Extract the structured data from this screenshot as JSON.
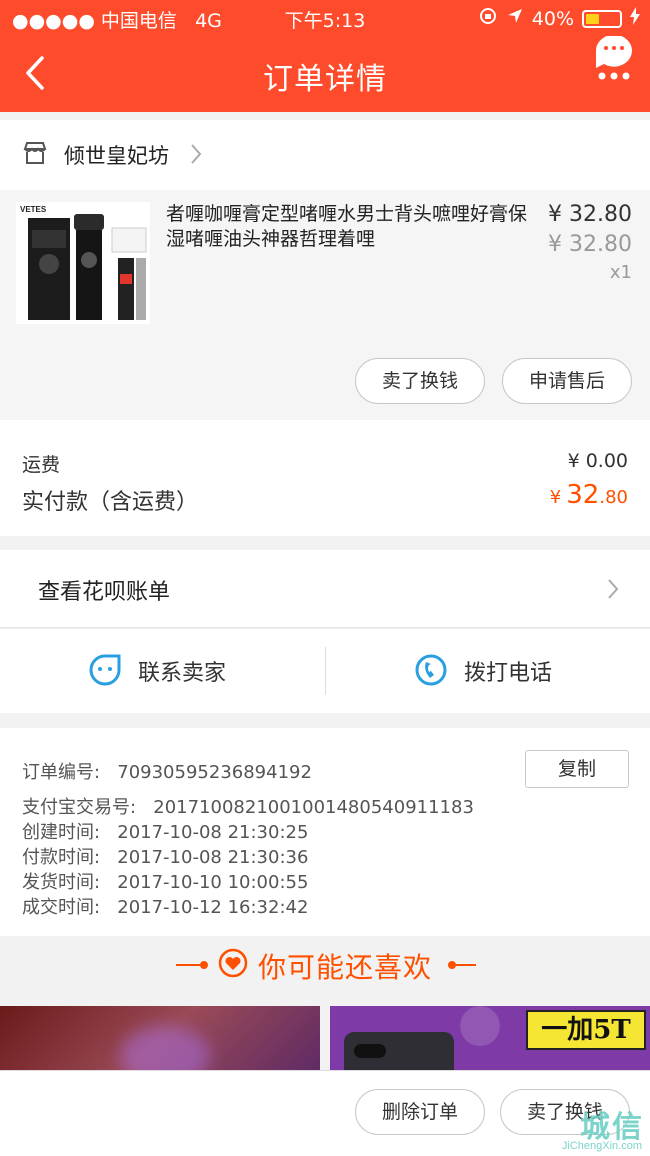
{
  "status_bar": {
    "carrier": "●●●●● 中国电信",
    "network": "4G",
    "time": "下午5:13",
    "battery_percent": "40%",
    "battery_level": 0.4
  },
  "nav": {
    "title": "订单详情"
  },
  "shop": {
    "name": "倾世皇妃坊"
  },
  "item": {
    "image_label": "VETES",
    "title": "者喱咖喱膏定型啫喱水男士背头嗻哩好膏保湿啫喱油头神器哲理着哩",
    "price": "¥ 32.80",
    "original_price": "¥ 32.80",
    "quantity": "x1",
    "button_sell": "卖了换钱",
    "button_after_sale": "申请售后"
  },
  "fees": {
    "shipping_label": "运费",
    "shipping_value": "¥ 0.00",
    "paid_label": "实付款（含运费）",
    "paid_currency": "¥",
    "paid_integer": "32",
    "paid_decimal": ".80"
  },
  "huabei": {
    "label": "查看花呗账单"
  },
  "contact": {
    "seller_label": "联系卖家",
    "phone_label": "拨打电话"
  },
  "order_info": {
    "order_no_label": "订单编号:",
    "order_no": "70930595236894192",
    "copy_button": "复制",
    "alipay_label": "支付宝交易号:",
    "alipay_no": "2017100821001001480540911183",
    "created_label": "创建时间:",
    "created": "2017-10-08 21:30:25",
    "paid_label": "付款时间:",
    "paid": "2017-10-08 21:30:36",
    "shipped_label": "发货时间:",
    "shipped": "2017-10-10 10:00:55",
    "completed_label": "成交时间:",
    "completed": "2017-10-12 16:32:42"
  },
  "recommend": {
    "title": "你可能还喜欢",
    "card2_badge": "一加5T"
  },
  "bottom_bar": {
    "delete_button": "删除订单",
    "sell_button": "卖了换钱"
  },
  "watermark": {
    "text": "城信",
    "url": "JiChengXin.com"
  },
  "colors": {
    "brand": "#fe4b2b",
    "price_accent": "#ff5000",
    "icon_blue": "#2a9fe0"
  }
}
